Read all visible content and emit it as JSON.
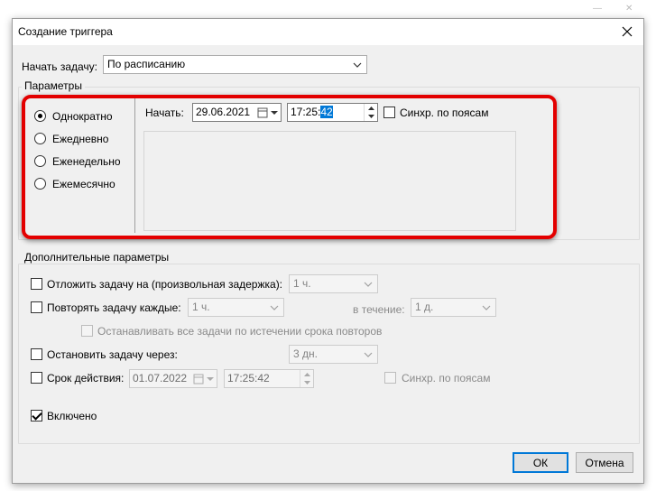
{
  "background_window": {
    "minimize_glyph": "—",
    "close_glyph": "✕"
  },
  "dialog": {
    "title": "Создание триггера",
    "start_task_label": "Начать задачу:",
    "start_task_value": "По расписанию",
    "params": {
      "legend": "Параметры",
      "radios": [
        {
          "label": "Однократно",
          "checked": true
        },
        {
          "label": "Ежедневно",
          "checked": false
        },
        {
          "label": "Еженедельно",
          "checked": false
        },
        {
          "label": "Ежемесячно",
          "checked": false
        }
      ],
      "start_label": "Начать:",
      "start_date": "29.06.2021",
      "start_time_prefix": "17:25:",
      "start_time_selected": "42",
      "sync_label": "Синхр. по поясам"
    },
    "advanced": {
      "legend": "Дополнительные параметры",
      "delay_label": "Отложить задачу на (произвольная задержка):",
      "delay_value": "1 ч.",
      "repeat_label": "Повторять задачу каждые:",
      "repeat_value": "1 ч.",
      "duration_label": "в течение:",
      "duration_value": "1 д.",
      "stop_all_label": "Останавливать все задачи по истечении срока повторов",
      "stop_after_label": "Остановить задачу через:",
      "stop_after_value": "3 дн.",
      "expire_label": "Срок действия:",
      "expire_date": "01.07.2022",
      "expire_time": "17:25:42",
      "expire_sync_label": "Синхр. по поясам",
      "enabled_label": "Включено"
    },
    "ok_label": "ОК",
    "cancel_label": "Отмена"
  }
}
